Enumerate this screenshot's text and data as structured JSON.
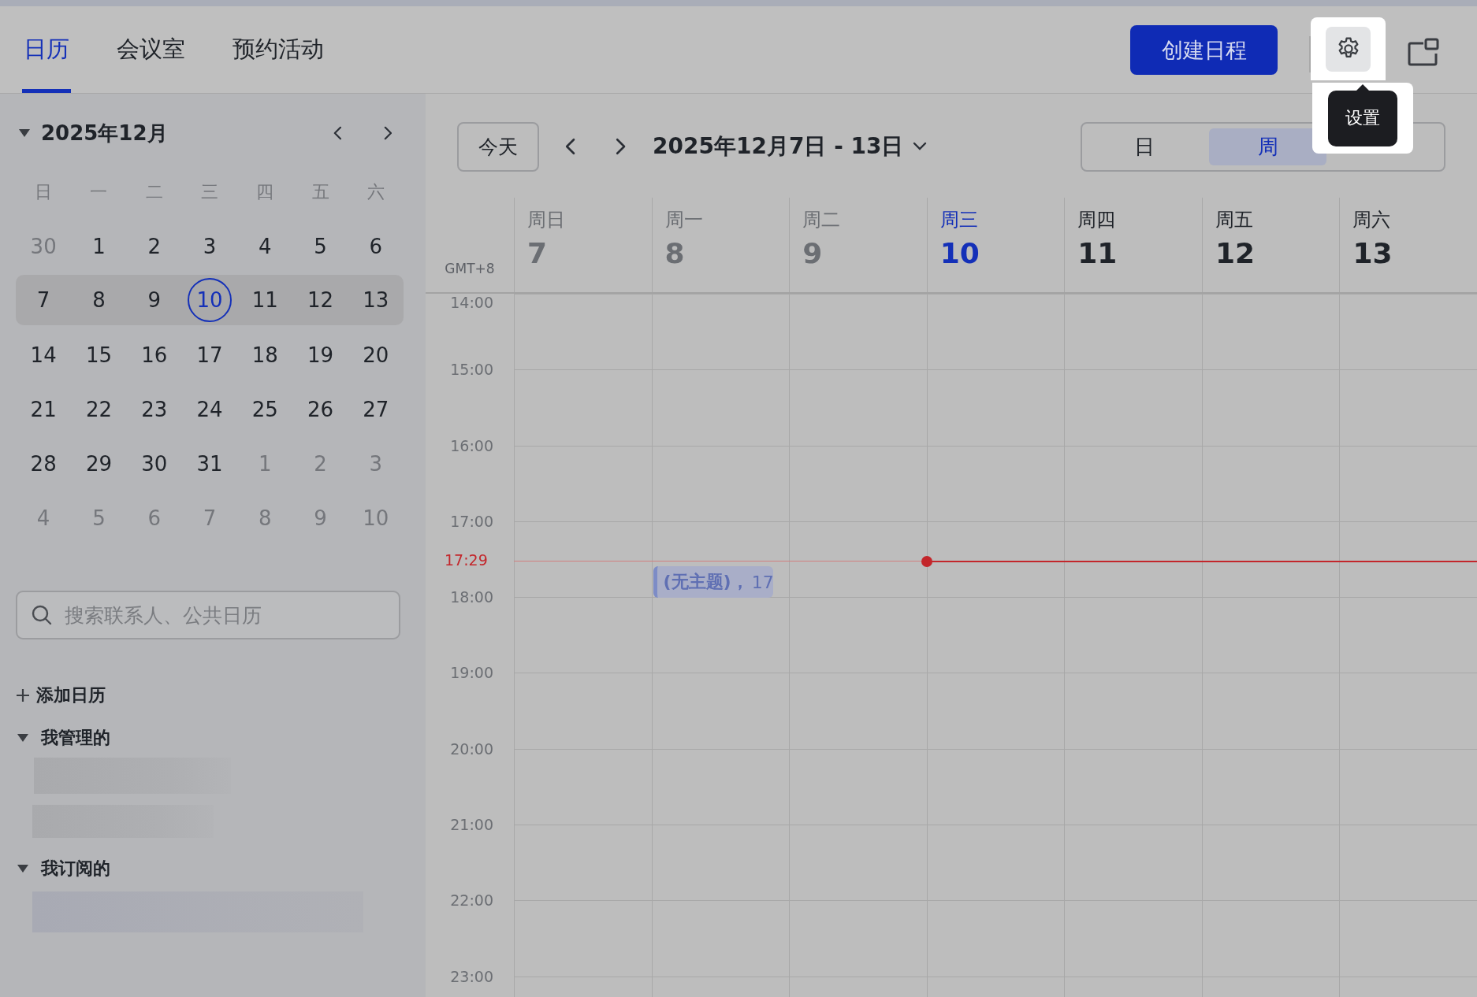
{
  "tabs": [
    {
      "label": "日历",
      "selected": true
    },
    {
      "label": "会议室",
      "selected": false
    },
    {
      "label": "预约活动",
      "selected": false
    }
  ],
  "create_button": "创建日程",
  "settings_tooltip": "设置",
  "mini_calendar": {
    "title": "2025年12月",
    "weekdays": [
      "日",
      "一",
      "二",
      "三",
      "四",
      "五",
      "六"
    ],
    "weeks": [
      {
        "selected": false,
        "days": [
          {
            "label": "30",
            "muted": true,
            "today": false
          },
          {
            "label": "1",
            "muted": false,
            "today": false
          },
          {
            "label": "2",
            "muted": false,
            "today": false
          },
          {
            "label": "3",
            "muted": false,
            "today": false
          },
          {
            "label": "4",
            "muted": false,
            "today": false
          },
          {
            "label": "5",
            "muted": false,
            "today": false
          },
          {
            "label": "6",
            "muted": false,
            "today": false
          }
        ]
      },
      {
        "selected": true,
        "days": [
          {
            "label": "7",
            "muted": false,
            "today": false
          },
          {
            "label": "8",
            "muted": false,
            "today": false
          },
          {
            "label": "9",
            "muted": false,
            "today": false
          },
          {
            "label": "10",
            "muted": false,
            "today": true
          },
          {
            "label": "11",
            "muted": false,
            "today": false
          },
          {
            "label": "12",
            "muted": false,
            "today": false
          },
          {
            "label": "13",
            "muted": false,
            "today": false
          }
        ]
      },
      {
        "selected": false,
        "days": [
          {
            "label": "14",
            "muted": false,
            "today": false
          },
          {
            "label": "15",
            "muted": false,
            "today": false
          },
          {
            "label": "16",
            "muted": false,
            "today": false
          },
          {
            "label": "17",
            "muted": false,
            "today": false
          },
          {
            "label": "18",
            "muted": false,
            "today": false
          },
          {
            "label": "19",
            "muted": false,
            "today": false
          },
          {
            "label": "20",
            "muted": false,
            "today": false
          }
        ]
      },
      {
        "selected": false,
        "days": [
          {
            "label": "21",
            "muted": false,
            "today": false
          },
          {
            "label": "22",
            "muted": false,
            "today": false
          },
          {
            "label": "23",
            "muted": false,
            "today": false
          },
          {
            "label": "24",
            "muted": false,
            "today": false
          },
          {
            "label": "25",
            "muted": false,
            "today": false
          },
          {
            "label": "26",
            "muted": false,
            "today": false
          },
          {
            "label": "27",
            "muted": false,
            "today": false
          }
        ]
      },
      {
        "selected": false,
        "days": [
          {
            "label": "28",
            "muted": false,
            "today": false
          },
          {
            "label": "29",
            "muted": false,
            "today": false
          },
          {
            "label": "30",
            "muted": false,
            "today": false
          },
          {
            "label": "31",
            "muted": false,
            "today": false
          },
          {
            "label": "1",
            "muted": true,
            "today": false
          },
          {
            "label": "2",
            "muted": true,
            "today": false
          },
          {
            "label": "3",
            "muted": true,
            "today": false
          }
        ]
      },
      {
        "selected": false,
        "days": [
          {
            "label": "4",
            "muted": true,
            "today": false
          },
          {
            "label": "5",
            "muted": true,
            "today": false
          },
          {
            "label": "6",
            "muted": true,
            "today": false
          },
          {
            "label": "7",
            "muted": true,
            "today": false
          },
          {
            "label": "8",
            "muted": true,
            "today": false
          },
          {
            "label": "9",
            "muted": true,
            "today": false
          },
          {
            "label": "10",
            "muted": true,
            "today": false
          }
        ]
      }
    ]
  },
  "search": {
    "placeholder": "搜索联系人、公共日历"
  },
  "add_calendar": "添加日历",
  "calendar_groups": [
    {
      "title": "我管理的",
      "expanded": true
    },
    {
      "title": "我订阅的",
      "expanded": true
    }
  ],
  "toolbar": {
    "today_button": "今天",
    "range": "2025年12月7日 - 13日"
  },
  "views": [
    {
      "label": "日",
      "selected": false
    },
    {
      "label": "周",
      "selected": true
    }
  ],
  "timezone": "GMT+8",
  "days": [
    {
      "weekday": "周日",
      "date": "7",
      "kind": "past"
    },
    {
      "weekday": "周一",
      "date": "8",
      "kind": "past",
      "events": [
        {
          "title": "(无主题)，",
          "time": "17"
        }
      ]
    },
    {
      "weekday": "周二",
      "date": "9",
      "kind": "past"
    },
    {
      "weekday": "周三",
      "date": "10",
      "kind": "today"
    },
    {
      "weekday": "周四",
      "date": "11",
      "kind": "future"
    },
    {
      "weekday": "周五",
      "date": "12",
      "kind": "future"
    },
    {
      "weekday": "周六",
      "date": "13",
      "kind": "future"
    }
  ],
  "hours": [
    "14:00",
    "15:00",
    "16:00",
    "17:00",
    "18:00",
    "19:00",
    "20:00",
    "21:00",
    "22:00",
    "23:00"
  ],
  "now_time": "17:29"
}
